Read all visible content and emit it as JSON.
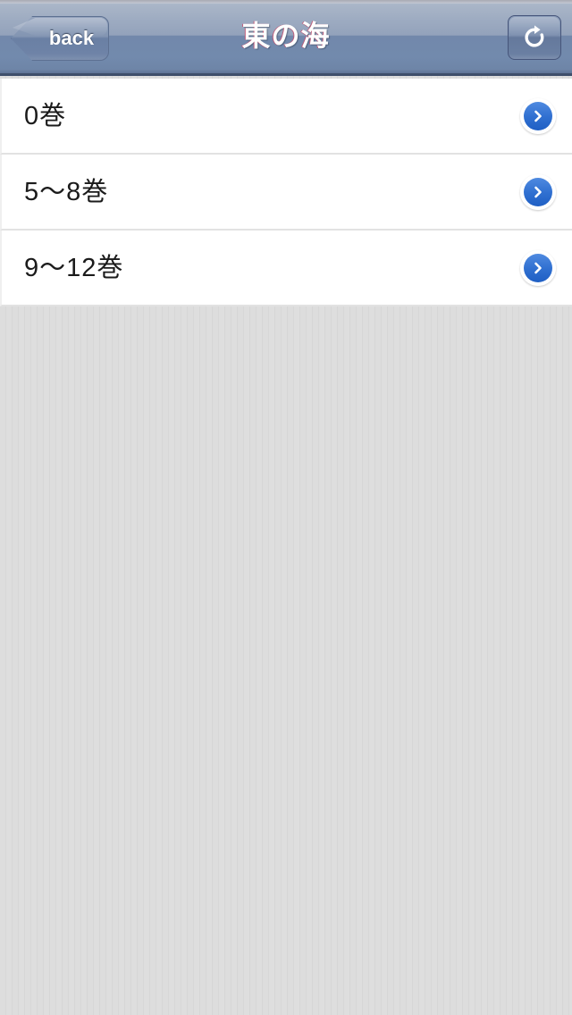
{
  "navbar": {
    "title": "東の海",
    "back_label": "back",
    "back_icon": "chevron-left-icon",
    "refresh_icon": "refresh-icon",
    "title_color": "#ffffff",
    "bar_color": "#7288ab"
  },
  "list": {
    "rows": [
      {
        "label": "0巻",
        "accessory_icon": "chevron-right-circle-icon"
      },
      {
        "label": "5〜8巻",
        "accessory_icon": "chevron-right-circle-icon"
      },
      {
        "label": "9〜12巻",
        "accessory_icon": "chevron-right-circle-icon"
      }
    ],
    "row_background": "#ffffff",
    "separator_color": "#e2e2e2",
    "accent_color": "#2f6fd0"
  },
  "background": {
    "pattern": "vertical-pinstripe",
    "base_color": "#dcdcdc"
  }
}
